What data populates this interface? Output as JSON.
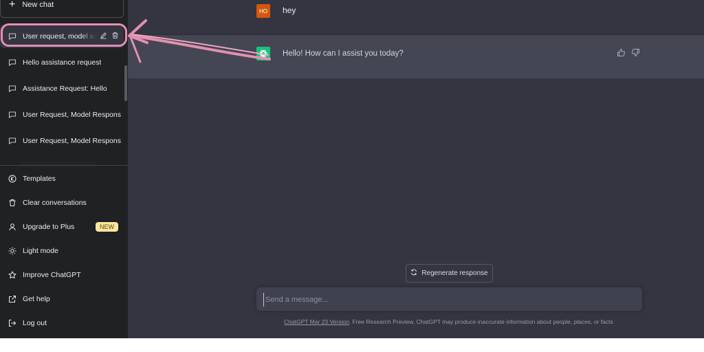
{
  "sidebar": {
    "new_chat": "New chat",
    "conversations": [
      {
        "label": "User request, model assi",
        "active": true
      },
      {
        "label": "Hello assistance request"
      },
      {
        "label": "Assistance Request: Hello"
      },
      {
        "label": "User Request, Model Respons"
      },
      {
        "label": "User Request, Model Respons"
      }
    ],
    "footer": [
      {
        "label": "Templates",
        "icon": "k-circle-icon"
      },
      {
        "label": "Clear conversations",
        "icon": "trash-icon"
      },
      {
        "label": "Upgrade to Plus",
        "icon": "user-icon",
        "badge": "NEW"
      },
      {
        "label": "Light mode",
        "icon": "sun-icon"
      },
      {
        "label": "Improve ChatGPT",
        "icon": "star-icon"
      },
      {
        "label": "Get help",
        "icon": "external-link-icon"
      },
      {
        "label": "Log out",
        "icon": "logout-icon"
      }
    ]
  },
  "chat": {
    "user_avatar": "HO",
    "user_message": "hey",
    "assistant_message": "Hello! How can I assist you today?"
  },
  "composer": {
    "regenerate": "Regenerate response",
    "placeholder": "Send a message..."
  },
  "footer": {
    "link": "ChatGPT Mar 23 Version",
    "text": ". Free Research Preview. ChatGPT may produce inaccurate information about people, places, or facts"
  },
  "colors": {
    "sidebar": "#202123",
    "main": "#343541",
    "assistant_row": "#444654",
    "highlight": "#e58fb0",
    "badge": "#fae69e"
  }
}
